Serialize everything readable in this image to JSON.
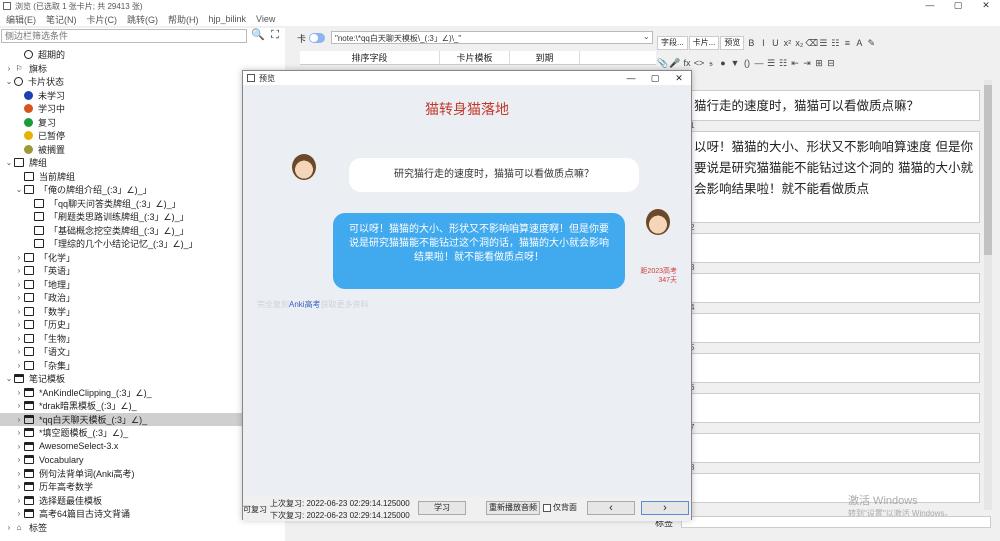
{
  "titlebar": {
    "title": "浏览 (已选取 1 张卡片; 共 29413 张)",
    "minimize": "—",
    "maximize": "▢",
    "close": "✕"
  },
  "menu": [
    "编辑(E)",
    "笔记(N)",
    "卡片(C)",
    "跳转(G)",
    "帮助(H)",
    "hjp_bilink",
    "View"
  ],
  "sidebar": {
    "filter_placeholder": "侧边栏筛选条件",
    "tools": {
      "search": "🔍",
      "select": "⛶"
    },
    "items": [
      {
        "label": "超期的",
        "indent": 1,
        "icon": "clock-icon",
        "arrow": "",
        "color": ""
      },
      {
        "label": "旗标",
        "indent": 0,
        "icon": "flag-icon",
        "arrow": "›",
        "color": ""
      },
      {
        "label": "卡片状态",
        "indent": 0,
        "icon": "circle-icon",
        "arrow": "⌄",
        "color": ""
      },
      {
        "label": "未学习",
        "indent": 1,
        "icon": "dot-icon",
        "arrow": "",
        "color": "#1f3fb4"
      },
      {
        "label": "学习中",
        "indent": 1,
        "icon": "dot-icon",
        "arrow": "",
        "color": "#d9531e"
      },
      {
        "label": "复习",
        "indent": 1,
        "icon": "dot-icon",
        "arrow": "",
        "color": "#1a9c3a"
      },
      {
        "label": "已暂停",
        "indent": 1,
        "icon": "dot-icon",
        "arrow": "",
        "color": "#e6b400"
      },
      {
        "label": "被搁置",
        "indent": 1,
        "icon": "dot-icon",
        "arrow": "",
        "color": "#9a9a3a"
      },
      {
        "label": "牌组",
        "indent": 0,
        "icon": "deck-icon",
        "arrow": "⌄",
        "color": ""
      },
      {
        "label": "当前牌组",
        "indent": 1,
        "icon": "current-deck-icon",
        "arrow": "",
        "color": ""
      },
      {
        "label": "「俺の牌组介绍_(:3」∠)_」",
        "indent": 1,
        "icon": "deck-icon",
        "arrow": "⌄",
        "color": ""
      },
      {
        "label": "「qq聊天问答类牌组_(:3」∠)_」",
        "indent": 2,
        "icon": "deck-icon",
        "arrow": "",
        "color": ""
      },
      {
        "label": "「刷题类思路训练牌组_(:3」∠)_」",
        "indent": 2,
        "icon": "deck-icon",
        "arrow": "",
        "color": ""
      },
      {
        "label": "「基础概念挖空类牌组_(:3」∠)_」",
        "indent": 2,
        "icon": "deck-icon",
        "arrow": "",
        "color": ""
      },
      {
        "label": "「理综的几个小结论记忆_(:3」∠)_」",
        "indent": 2,
        "icon": "deck-icon",
        "arrow": "",
        "color": ""
      },
      {
        "label": "「化学」",
        "indent": 1,
        "icon": "deck-icon",
        "arrow": "›",
        "color": ""
      },
      {
        "label": "「英语」",
        "indent": 1,
        "icon": "deck-icon",
        "arrow": "›",
        "color": ""
      },
      {
        "label": "「地理」",
        "indent": 1,
        "icon": "deck-icon",
        "arrow": "›",
        "color": ""
      },
      {
        "label": "「政治」",
        "indent": 1,
        "icon": "deck-icon",
        "arrow": "›",
        "color": ""
      },
      {
        "label": "「数学」",
        "indent": 1,
        "icon": "deck-icon",
        "arrow": "›",
        "color": ""
      },
      {
        "label": "「历史」",
        "indent": 1,
        "icon": "deck-icon",
        "arrow": "›",
        "color": ""
      },
      {
        "label": "「生物」",
        "indent": 1,
        "icon": "deck-icon",
        "arrow": "›",
        "color": ""
      },
      {
        "label": "「语文」",
        "indent": 1,
        "icon": "deck-icon",
        "arrow": "›",
        "color": ""
      },
      {
        "label": "「杂集」",
        "indent": 1,
        "icon": "deck-icon",
        "arrow": "›",
        "color": ""
      },
      {
        "label": "笔记模板",
        "indent": 0,
        "icon": "notetype-icon",
        "arrow": "⌄",
        "color": ""
      },
      {
        "label": "*AnKindleClipping_(:3」∠)_",
        "indent": 1,
        "icon": "notetype-icon",
        "arrow": "›",
        "color": ""
      },
      {
        "label": "*drak暗黑模板_(:3」∠)_",
        "indent": 1,
        "icon": "notetype-icon",
        "arrow": "›",
        "color": ""
      },
      {
        "label": "*qq白天聊天模板_(:3」∠)_",
        "indent": 1,
        "icon": "notetype-icon",
        "arrow": "›",
        "color": "",
        "selected": true
      },
      {
        "label": "*填空题模板_(:3」∠)_",
        "indent": 1,
        "icon": "notetype-icon",
        "arrow": "›",
        "color": ""
      },
      {
        "label": "AwesomeSelect-3.x",
        "indent": 1,
        "icon": "notetype-icon",
        "arrow": "›",
        "color": ""
      },
      {
        "label": "Vocabulary",
        "indent": 1,
        "icon": "notetype-icon",
        "arrow": "›",
        "color": ""
      },
      {
        "label": "例句法背单词(Anki高考)",
        "indent": 1,
        "icon": "notetype-icon",
        "arrow": "›",
        "color": ""
      },
      {
        "label": "历年高考数学",
        "indent": 1,
        "icon": "notetype-icon",
        "arrow": "›",
        "color": ""
      },
      {
        "label": "选择题最佳模板",
        "indent": 1,
        "icon": "notetype-icon",
        "arrow": "›",
        "color": ""
      },
      {
        "label": "高考64篇目古诗文背诵",
        "indent": 1,
        "icon": "notetype-icon",
        "arrow": "›",
        "color": ""
      },
      {
        "label": "标签",
        "indent": 0,
        "icon": "tag-icon",
        "arrow": "›",
        "color": ""
      }
    ]
  },
  "browser": {
    "toggle_label": "卡",
    "search_value": "\"note:\\*qq白天聊天模板\\_(:3」∠)\\_\"",
    "columns": [
      "排序字段",
      "卡片模板",
      "到期"
    ]
  },
  "editor": {
    "toolbar_buttons": [
      "字段...",
      "卡片...",
      "预览"
    ],
    "format_row1": [
      "B",
      "I",
      "U",
      "x²",
      "x₂",
      "⌫",
      "☰",
      "☷",
      "≡",
      "A",
      "✎"
    ],
    "format_row2": [
      "📎",
      "🎤",
      "fx",
      "<>",
      "𝔰",
      "●",
      "▼",
      "()",
      "—",
      "☰",
      "☷",
      "⇤",
      "⇥",
      "⊞",
      "⊟"
    ],
    "fields": [
      {
        "num": "",
        "text": "猫行走的速度时，猫猫可以看做质点嘛？"
      },
      {
        "num": "1",
        "text": "以呀！猫猫的大小、形状又不影响咱算速度 但是你要说是研究猫猫能不能钻过这个洞的 猫猫的大小就会影响结果啦！就不能看做质点"
      },
      {
        "num": "2",
        "text": ""
      },
      {
        "num": "3",
        "text": ""
      },
      {
        "num": "4",
        "text": ""
      },
      {
        "num": "5",
        "text": ""
      },
      {
        "num": "6",
        "text": ""
      },
      {
        "num": "7",
        "text": ""
      },
      {
        "num": "8",
        "text": ""
      }
    ],
    "tags_label": "标签",
    "watermark_title": "激活 Windows",
    "watermark_sub": "转到\"设置\"以激活 Windows。"
  },
  "preview": {
    "window_title": "预览",
    "heading": "猫转身猫落地",
    "question": "研究猫行走的速度时，猫猫可以看做质点嘛？",
    "answer": "可以呀！猫猫的大小、形状又不影响咱算速度啊！但是你要说是研究猫猫能不能钻过这个洞的话，猫猫的大小就会影响结果啦！就不能看做质点呀！",
    "countdown_top": "距2023高考",
    "countdown_days": "347天",
    "footer_prefix": "完全复刻",
    "footer_link": "Anki高考",
    "footer_suffix": "获取更多资料",
    "status_left": "可复习",
    "last_review": "上次复习: 2022-06-23 02:29:14.125000",
    "next_review": "下次复习: 2022-06-23 02:29:14.125000",
    "btn_study": "学习",
    "btn_replay": "重新播放音频",
    "checkbox_back": "仅背面",
    "btn_prev": "‹",
    "btn_next": "›"
  }
}
